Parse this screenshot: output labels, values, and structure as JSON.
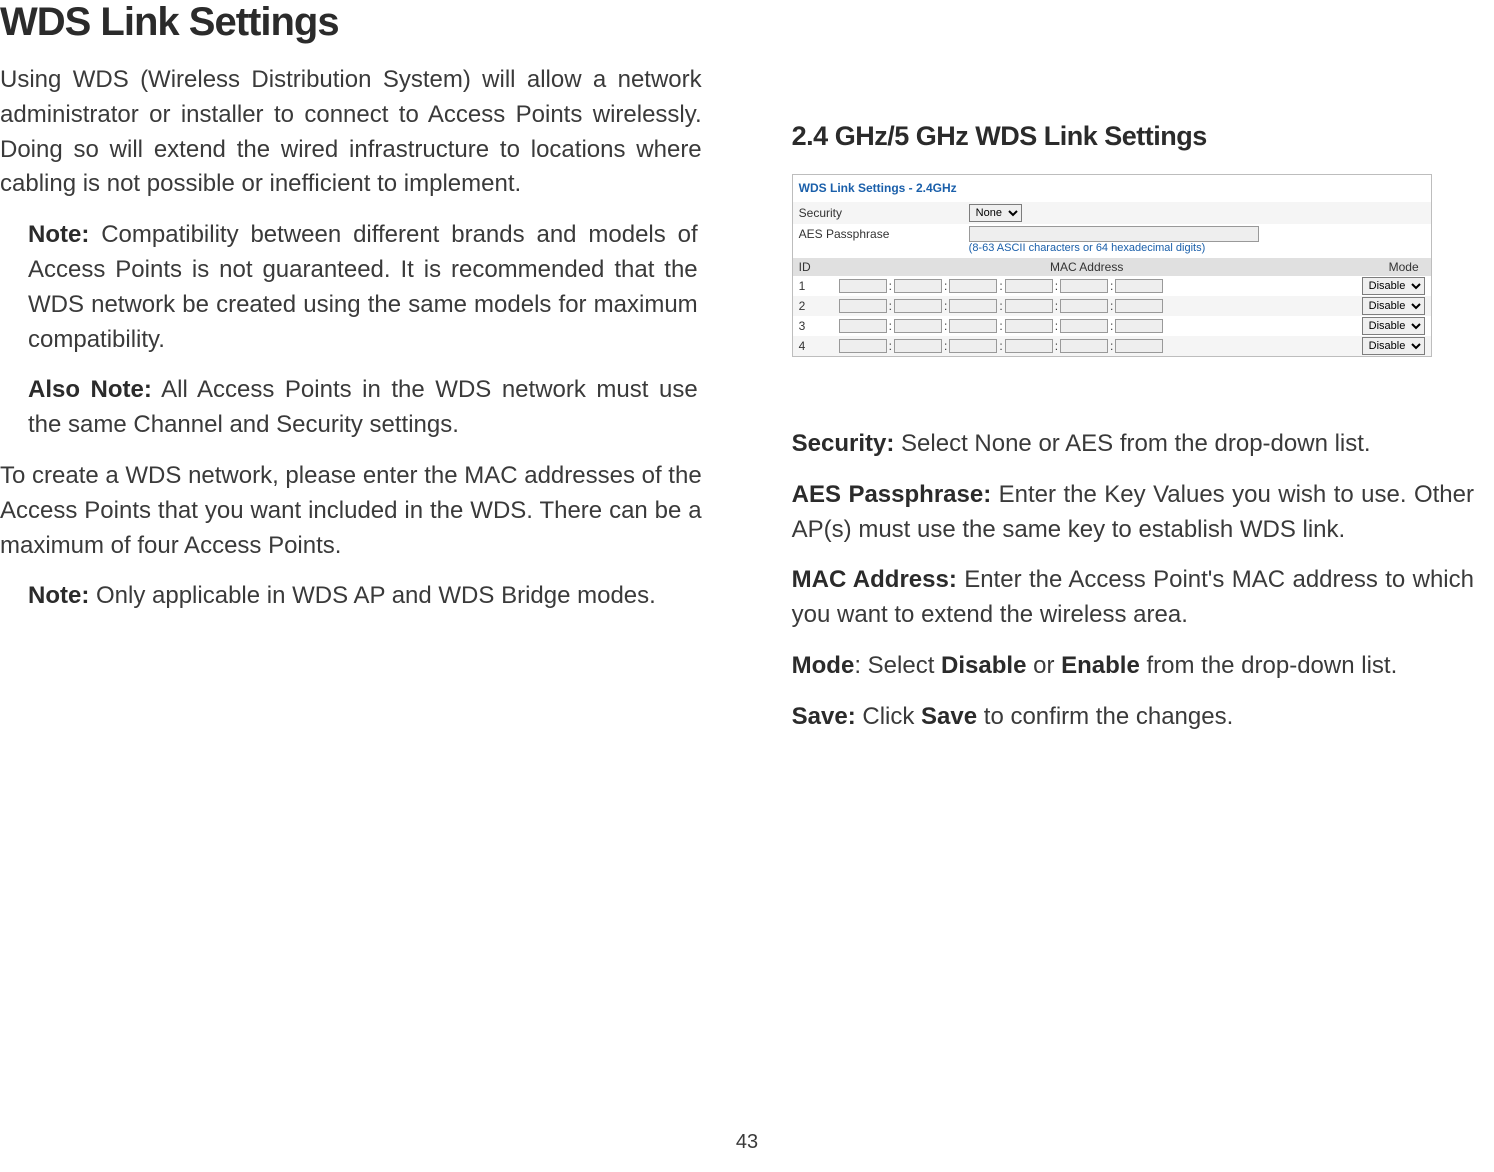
{
  "title": "WDS Link Settings",
  "left": {
    "p1": "Using WDS (Wireless Distribution System) will allow a network administrator or installer to connect to Access Points wirelessly. Doing so will extend the wired infrastructure to locations where cabling is not possible or inefficient to implement.",
    "note1_label": "Note:",
    "note1_text": " Compatibility between different brands and models of Access Points is not guaranteed. It is recommended that the WDS network be created using the same models for maximum compatibility.",
    "note2_label": "Also Note:",
    "note2_text": " All Access Points in the WDS network must use the same Channel and Security settings.",
    "p2": "To create a WDS network, please enter the MAC addresses of the Access Points that you want included in the WDS. There can be a maximum of four Access Points.",
    "note3_label": "Note:",
    "note3_text": " Only applicable in WDS AP and WDS Bridge modes."
  },
  "right_heading": "2.4 GHz/5 GHz WDS Link Settings",
  "table": {
    "title": "WDS Link Settings - 2.4GHz",
    "security_label": "Security",
    "security_value": "None",
    "aes_label": "AES Passphrase",
    "aes_hint": "(8-63 ASCII characters or 64 hexadecimal digits)",
    "hdr_id": "ID",
    "hdr_mac": "MAC Address",
    "hdr_mode": "Mode",
    "rows": [
      {
        "id": "1",
        "mode": "Disable"
      },
      {
        "id": "2",
        "mode": "Disable"
      },
      {
        "id": "3",
        "mode": "Disable"
      },
      {
        "id": "4",
        "mode": "Disable"
      }
    ]
  },
  "defs": {
    "security_label": "Security:",
    "security_text": " Select None or AES from the drop-down list.",
    "aes_label": "AES Passphrase:",
    "aes_text": " Enter the Key Values you wish to use. Other AP(s) must use the same key to establish WDS link.",
    "mac_label": "MAC Address:",
    "mac_text": " Enter the Access Point's MAC address to which you want to extend the wireless area.",
    "mode_label": "Mode",
    "mode_mid": ": Select ",
    "mode_disable": "Disable",
    "mode_or": " or ",
    "mode_enable": "Enable",
    "mode_end": " from the drop-down list.",
    "save_label": "Save:",
    "save_mid": " Click ",
    "save_btn": "Save",
    "save_end": " to confirm the changes."
  },
  "page_number": "43"
}
